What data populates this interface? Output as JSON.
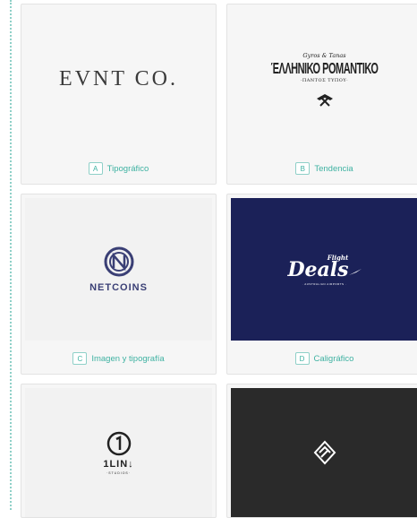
{
  "cards": [
    {
      "badge": "A",
      "label": "Tipográfico",
      "logo_text": "EVNT CO.",
      "background": "#f6f6f6"
    },
    {
      "badge": "B",
      "label": "Tendencia",
      "logo_script": "Gyros & Tanas",
      "logo_text": "ΈΛΛΗΝΙΚΟ ΡΟΜΑΝΤΙΚΟ",
      "logo_sub": "·ΠΑΝΤΟΣ ΤΥΠΟΥ·",
      "icon": "crossed-tools-icon",
      "background": "#f6f6f6"
    },
    {
      "badge": "C",
      "label": "Imagen y tipografía",
      "logo_text": "NETCOINS",
      "icon": "netcoins-emblem-icon",
      "background": "#f6f6f6"
    },
    {
      "badge": "D",
      "label": "Caligráfico",
      "logo_script": "Flight",
      "logo_text": "Deals",
      "logo_sub": "· AUSTRALIAN AIRPORTS ·",
      "icon": "airplane-icon",
      "background": "#1b2158"
    },
    {
      "logo_text": "1LIN",
      "logo_sub": "·STUDIOS·",
      "icon": "circled-one-icon",
      "background": "#f6f6f6"
    },
    {
      "icon": "geometric-diamond-icon",
      "background": "#2a2a2a"
    }
  ],
  "colors": {
    "accent": "#3fb2a2",
    "badge_border": "#8fd0c8",
    "netcoins": "#3a3f75",
    "deals_bg": "#1b2158",
    "dark_bg": "#2a2a2a"
  }
}
